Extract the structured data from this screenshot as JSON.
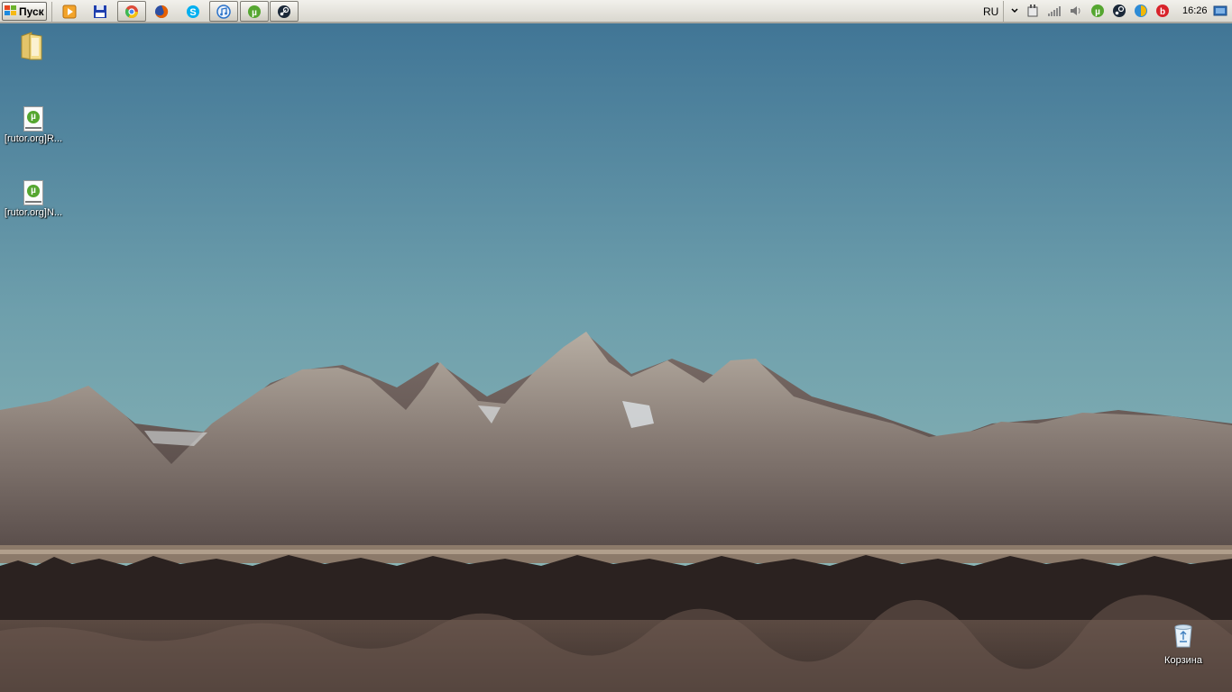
{
  "taskbar": {
    "start_label": "Пуск",
    "quick_launch": [
      {
        "name": "media-player-icon",
        "color": "#f08a1c"
      },
      {
        "name": "save-disk-icon",
        "color": "#1f3fae"
      },
      {
        "name": "chrome-icon",
        "color": "#dd4b39"
      },
      {
        "name": "firefox-icon",
        "color": "#e66000"
      },
      {
        "name": "skype-icon",
        "color": "#00aff0"
      },
      {
        "name": "itunes-icon",
        "color": "#2a72c9"
      },
      {
        "name": "utorrent-icon",
        "color": "#55a630"
      },
      {
        "name": "steam-icon",
        "color": "#1b2838"
      }
    ],
    "tray": {
      "language": "RU",
      "clock": "16:26"
    }
  },
  "desktop": {
    "icons": [
      {
        "label": "",
        "icon": "folder-icon"
      },
      {
        "label": "[rutor.org]R...",
        "icon": "torrent-file-icon"
      },
      {
        "label": "[rutor.org]N...",
        "icon": "torrent-file-icon"
      },
      {
        "label": "Корзина",
        "icon": "recycle-bin-icon"
      }
    ],
    "torrent_badge": "µ"
  },
  "colors": {
    "sky_top": "#3d7294",
    "sky_bottom": "#8fb8b9",
    "mountain": "#8a7f78",
    "forest": "#2e2522",
    "utorrent_green": "#55a630"
  }
}
